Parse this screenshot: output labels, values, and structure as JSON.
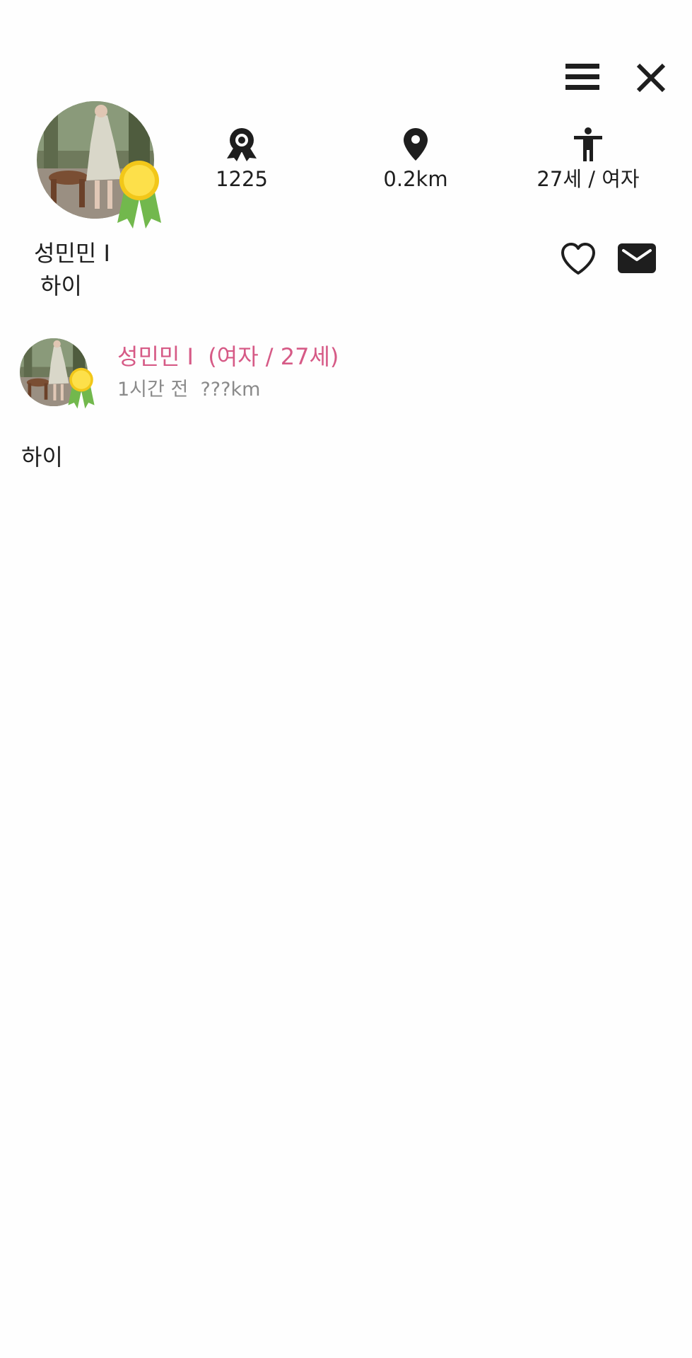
{
  "header": {
    "menu_icon": "hamburger-menu-icon",
    "close_icon": "close-icon"
  },
  "profile": {
    "name": "성민민 I",
    "status": "하이",
    "stats": {
      "points": "1225",
      "distance": "0.2km",
      "age_gender": "27세 / 여자"
    },
    "stat_icons": [
      "award-badge-icon",
      "location-pin-icon",
      "person-icon"
    ],
    "badge_colors": {
      "medal": "#fde04a",
      "ribbon": "#72b84d"
    }
  },
  "actions": {
    "like_icon": "heart-icon",
    "message_icon": "mail-icon"
  },
  "post": {
    "author": "성민민 I  (여자 / 27세)",
    "time": "1시간 전",
    "distance": "???km",
    "body": "하이"
  },
  "colors": {
    "author_accent": "#d65a86",
    "meta_gray": "#8a8a8a",
    "text": "#1e1e1e"
  }
}
